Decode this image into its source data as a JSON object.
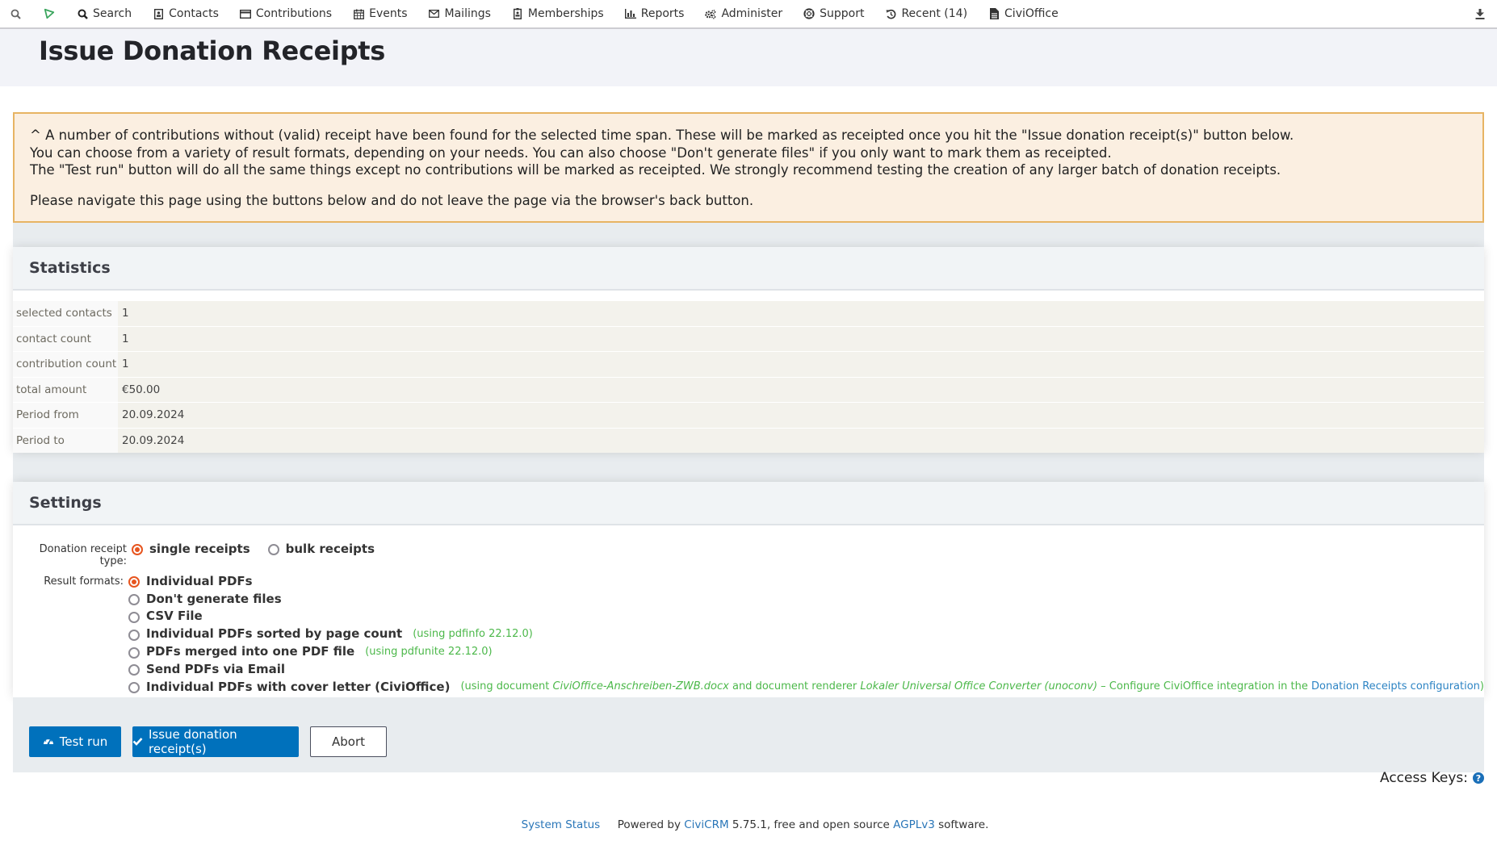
{
  "nav": {
    "items": [
      {
        "label": "Search",
        "icon": "search-icon"
      },
      {
        "label": "Contacts",
        "icon": "contact-card-icon"
      },
      {
        "label": "Contributions",
        "icon": "credit-card-icon"
      },
      {
        "label": "Events",
        "icon": "calendar-icon"
      },
      {
        "label": "Mailings",
        "icon": "envelope-icon"
      },
      {
        "label": "Memberships",
        "icon": "id-badge-icon"
      },
      {
        "label": "Reports",
        "icon": "bar-chart-icon"
      },
      {
        "label": "Administer",
        "icon": "gears-icon"
      },
      {
        "label": "Support",
        "icon": "life-ring-icon"
      },
      {
        "label": "Recent (14)",
        "icon": "history-icon"
      },
      {
        "label": "CiviOffice",
        "icon": "document-icon"
      }
    ]
  },
  "page": {
    "title": "Issue Donation Receipts"
  },
  "info": {
    "lines": [
      "^ A number of contributions without (valid) receipt have been found for the selected time span. These will be marked as receipted once you hit the \"Issue donation receipt(s)\" button below.",
      "You can choose from a variety of result formats, depending on your needs. You can also choose \"Don't generate files\" if you only want to mark them as receipted.",
      "The \"Test run\" button will do all the same things except no contributions will be marked as receipted. We strongly recommend testing the creation of any larger batch of donation receipts."
    ],
    "navigation_note": "Please navigate this page using the buttons below and do not leave the page via the browser's back button."
  },
  "statistics": {
    "title": "Statistics",
    "rows": [
      {
        "label": "selected contacts",
        "value": "1"
      },
      {
        "label": "contact count",
        "value": "1"
      },
      {
        "label": "contribution count",
        "value": "1"
      },
      {
        "label": "total amount",
        "value": "€50.00"
      },
      {
        "label": "Period from",
        "value": "20.09.2024"
      },
      {
        "label": "Period to",
        "value": "20.09.2024"
      }
    ]
  },
  "settings": {
    "title": "Settings",
    "receipt_type_label": "Donation receipt type:",
    "receipt_types": [
      {
        "label": "single receipts",
        "selected": true
      },
      {
        "label": "bulk receipts",
        "selected": false
      }
    ],
    "result_formats_label": "Result formats:",
    "result_formats": [
      {
        "label": "Individual PDFs",
        "selected": true,
        "note": ""
      },
      {
        "label": "Don't generate files",
        "selected": false,
        "note": ""
      },
      {
        "label": "CSV File",
        "selected": false,
        "note": ""
      },
      {
        "label": "Individual PDFs sorted by page count",
        "selected": false,
        "note": "(using pdfinfo 22.12.0)"
      },
      {
        "label": "PDFs merged into one PDF file",
        "selected": false,
        "note": "(using pdfunite 22.12.0)"
      },
      {
        "label": "Send PDFs via Email",
        "selected": false,
        "note": ""
      },
      {
        "label": "Individual PDFs with cover letter (CiviOffice)",
        "selected": false,
        "note": ""
      }
    ],
    "civioffice_note": {
      "prefix": "(using document ",
      "document": "CiviOffice-Anschreiben-ZWB.docx",
      "middle": " and document renderer ",
      "renderer": "Lokaler Universal Office Converter (unoconv)",
      "suffix": " – Configure CiviOffice integration in the ",
      "link": "Donation Receipts configuration",
      "end": ")"
    }
  },
  "buttons": {
    "test_run": "Test run",
    "issue": "Issue donation receipt(s)",
    "abort": "Abort"
  },
  "access_keys": {
    "label": "Access Keys:"
  },
  "footer": {
    "system_status": "System Status",
    "powered_by": "Powered by",
    "civicrm": "CiviCRM",
    "version_text": "5.75.1, free and open source",
    "license": "AGPLv3",
    "software": "software."
  },
  "colors": {
    "primary": "#0071bc",
    "accent_radio": "#e7551f",
    "note_green": "#4cb84a",
    "link": "#2d84c4",
    "warning_bg": "#fbefe1",
    "warning_border": "#e7b463"
  }
}
